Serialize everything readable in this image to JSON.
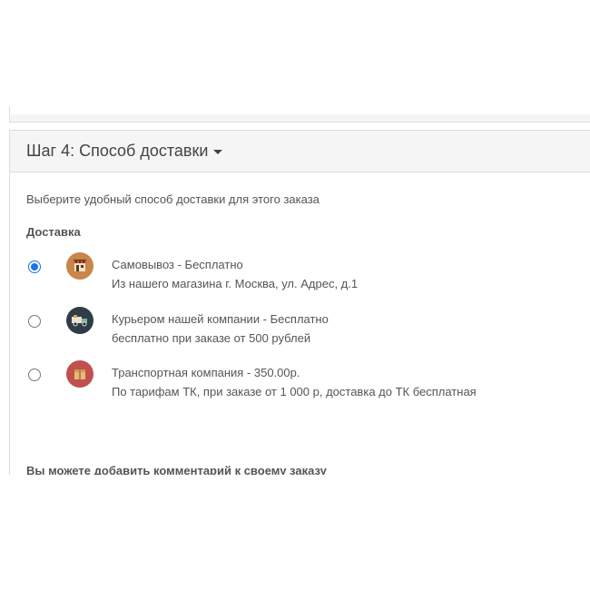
{
  "step": {
    "title": "Шаг 4: Способ доставки"
  },
  "intro_text": "Выберите удобный способ доставки для этого заказа",
  "section_label": "Доставка",
  "options": [
    {
      "title": "Самовывоз - Бесплатно",
      "description": "Из нашего магазина г. Москва, ул. Адрес, д.1",
      "selected": true,
      "icon": "store-icon",
      "icon_color": "#c8864a"
    },
    {
      "title": "Курьером нашей компании - Бесплатно",
      "description": "бесплатно при заказе от 500 рублей",
      "selected": false,
      "icon": "courier-truck-icon",
      "icon_color": "#2f3e46"
    },
    {
      "title": "Транспортная компания - 350.00р.",
      "description": "По тарифам ТК, при заказе от 1 000 р, доставка до ТК бесплатная",
      "selected": false,
      "icon": "package-icon",
      "icon_color": "#c0504d"
    }
  ],
  "comment_label": "Вы можете добавить комментарий к своему заказу",
  "comment_value": "",
  "colors": {
    "accent": "#1a73e8",
    "panel_heading_bg": "#f5f5f5",
    "border": "#dddddd"
  }
}
